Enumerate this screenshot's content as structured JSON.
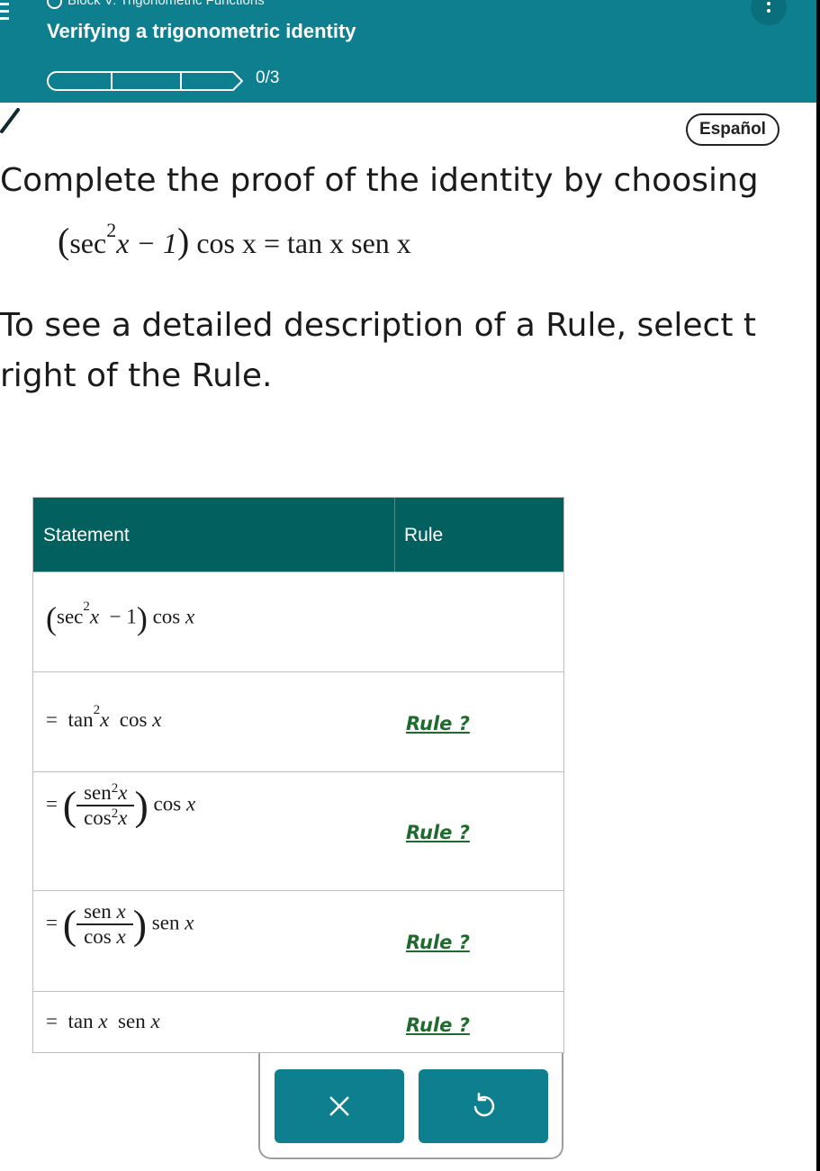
{
  "header": {
    "breadcrumb": "Block V: Trigonometric Functions",
    "title": "Verifying a trigonometric identity",
    "progress_text": "0/3",
    "progress_fraction": 0
  },
  "language_button": "Español",
  "instructions": {
    "line1": "Complete the proof of the identity by choosing",
    "line2": "To see a detailed description of a Rule, select t right of the Rule."
  },
  "identity": {
    "lhs_open": "(",
    "sec": "sec",
    "sq": "2",
    "x_minus_1": "x − 1",
    "lhs_close": ")",
    "cos_x": "cos x",
    "equals": "=",
    "tan_x": "tan x",
    "sen_x": "sen x"
  },
  "table": {
    "headers": {
      "statement": "Statement",
      "rule": "Rule"
    },
    "rule_link_label": "Rule ?",
    "rows": [
      {
        "statement": "(sec²x − 1) cos x"
      },
      {
        "statement": "= tan²x cos x"
      },
      {
        "statement": "= (sen²x / cos²x) cos x"
      },
      {
        "statement": "= (sen x / cos x) sen x"
      },
      {
        "statement": "= tan x sen x"
      }
    ]
  },
  "actions": {
    "clear_icon": "x-icon",
    "undo_icon": "undo-icon"
  },
  "colors": {
    "header_bg": "#0e7f8e",
    "table_header_bg": "#02605e",
    "rule_link": "#1f6b2e"
  }
}
